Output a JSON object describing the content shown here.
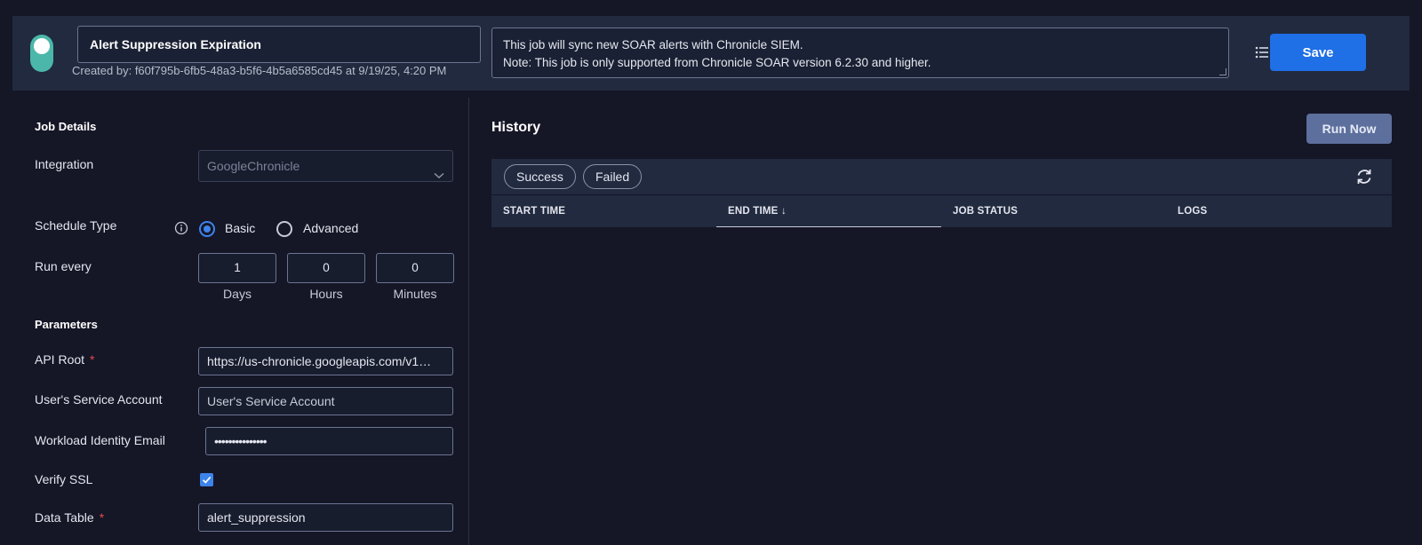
{
  "header": {
    "job_name": "Alert Suppression Expiration",
    "created_by": "Created by: f60f795b-6fb5-48a3-b5f6-4b5a6585cd45 at 9/19/25, 4:20 PM",
    "description_line1": "This job will sync new SOAR alerts with Chronicle SIEM.",
    "description_line2": "Note: This job is only supported from Chronicle SOAR version 6.2.30 and higher.",
    "save_label": "Save"
  },
  "job_details": {
    "section_title": "Job Details",
    "integration_label": "Integration",
    "integration_value": "GoogleChronicle",
    "schedule_type_label": "Schedule Type",
    "schedule_options": [
      "Basic",
      "Advanced"
    ],
    "selected_schedule": "Basic",
    "run_every_label": "Run every",
    "run_every": {
      "days": "1",
      "hours": "0",
      "minutes": "0",
      "days_label": "Days",
      "hours_label": "Hours",
      "minutes_label": "Minutes"
    }
  },
  "parameters": {
    "section_title": "Parameters",
    "api_root_label": "API Root",
    "api_root_value": "https://us-chronicle.googleapis.com/v1…",
    "service_account_label": "User's Service Account",
    "service_account_placeholder": "User's Service Account",
    "workload_email_label": "Workload Identity Email",
    "workload_email_value": "•••••••••••••••",
    "verify_ssl_label": "Verify SSL",
    "verify_ssl_checked": true,
    "data_table_label": "Data Table",
    "data_table_value": "alert_suppression",
    "required_mark": "*"
  },
  "history": {
    "title": "History",
    "run_now_label": "Run Now",
    "filters": [
      "Success",
      "Failed"
    ],
    "columns": [
      "START TIME",
      "END TIME ↓",
      "JOB STATUS",
      "LOGS"
    ]
  },
  "colors": {
    "accent": "#1f6fe6",
    "toggle_on": "#4bb7aa",
    "required": "#e5484d",
    "background": "#151626",
    "panel": "#212a3f"
  }
}
